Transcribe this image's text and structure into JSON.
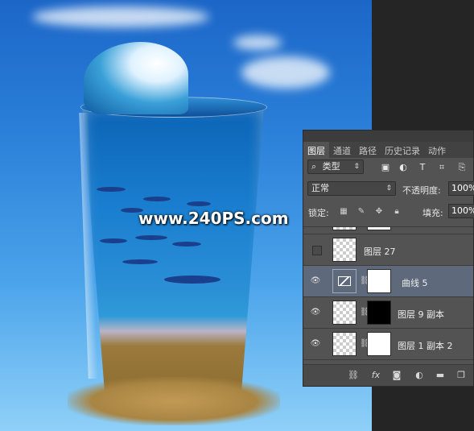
{
  "watermark": "www.240PS.com",
  "panel": {
    "tabs": [
      {
        "label": "图层",
        "active": true
      },
      {
        "label": "通道",
        "active": false
      },
      {
        "label": "路径",
        "active": false
      },
      {
        "label": "历史记录",
        "active": false
      },
      {
        "label": "动作",
        "active": false
      }
    ],
    "filter": {
      "search_icon": "⌕",
      "value": "类型",
      "icons": [
        "image-filter-icon",
        "adjustment-filter-icon",
        "type-filter-icon",
        "shape-filter-icon",
        "smart-object-filter-icon"
      ]
    },
    "blend_mode": "正常",
    "opacity_label": "不透明度:",
    "opacity_value": "100%",
    "lock_label": "锁定:",
    "fill_label": "填充:",
    "fill_value": "100%",
    "layers": [
      {
        "name": "图层 27",
        "visible": false,
        "selected": false
      },
      {
        "name": "曲线 5",
        "visible": true,
        "selected": true
      },
      {
        "name": "图层 9 副本",
        "visible": true,
        "selected": false
      },
      {
        "name": "图层 1 副本 2",
        "visible": true,
        "selected": false
      }
    ],
    "bottom_icons": [
      "link-icon",
      "fx-icon",
      "add-mask-icon",
      "adjustment-layer-icon",
      "new-group-icon",
      "new-layer-icon"
    ],
    "fx_label": "fx"
  },
  "colors": {
    "panel_bg": "#535353",
    "selected_row": "#5e6a7b",
    "sky": "#2a7fd8"
  }
}
